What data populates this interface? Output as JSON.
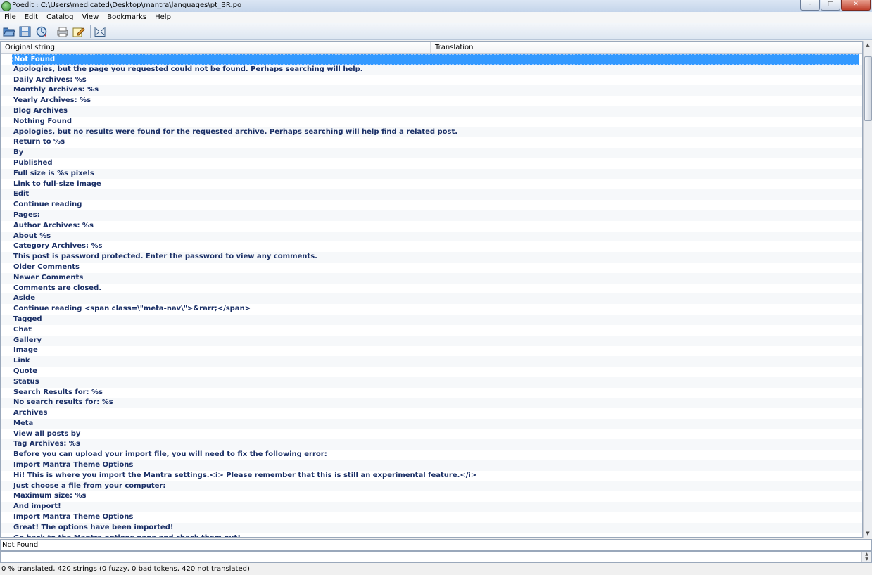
{
  "window": {
    "title": "Poedit : C:\\Users\\medicated\\Desktop\\mantra\\languages\\pt_BR.po",
    "minimize": "–",
    "maximize": "□",
    "close": "✕"
  },
  "menu": [
    "File",
    "Edit",
    "Catalog",
    "View",
    "Bookmarks",
    "Help"
  ],
  "toolbar": {
    "icons": [
      "open-icon",
      "save-icon",
      "update-icon",
      "validate-icon",
      "edit-comment-icon",
      "fullscreen-icon"
    ]
  },
  "list": {
    "col_original": "Original string",
    "col_translation": "Translation",
    "selected_index": 0,
    "rows": [
      "Not Found",
      "Apologies, but the page you requested could not be found. Perhaps searching will help.",
      "Daily Archives: %s",
      "Monthly Archives: %s",
      "Yearly Archives: %s",
      "Blog Archives",
      "Nothing Found",
      "Apologies, but no results were found for the requested archive. Perhaps searching will help find a related post.",
      "Return to %s",
      "By",
      "Published",
      "Full size is %s pixels",
      "Link to full-size image",
      "Edit",
      "Continue reading",
      "Pages:",
      "Author Archives: %s",
      "About %s",
      "Category Archives: %s",
      "This post is password protected. Enter the password to view any comments.",
      "Older Comments",
      "Newer Comments",
      "Comments are closed.",
      "Aside",
      "Continue reading <span class=\\\"meta-nav\\\">&rarr;</span>",
      "Tagged",
      "Chat",
      "Gallery",
      "Image",
      "Link",
      "Quote",
      "Status",
      "Search Results for: %s",
      "No search results for: %s",
      "Archives",
      "Meta",
      "View all posts by",
      "Tag Archives: %s",
      "Before you can upload your import file, you will need to fix the following error:",
      "Import Mantra Theme Options",
      "Hi! This is where you import the  Mantra settings.<i> Please remember that this is still an experimental feature.</i>",
      "Just choose a file from your computer:",
      "Maximum size: %s",
      "And import!",
      "Import Mantra Theme Options",
      "Great! The options have been imported!",
      "Go back to the Mantra options page and check them out!"
    ]
  },
  "source_text": "Not Found",
  "translation_text": "",
  "status": "0 % translated, 420 strings (0 fuzzy, 0 bad tokens, 420 not translated)"
}
